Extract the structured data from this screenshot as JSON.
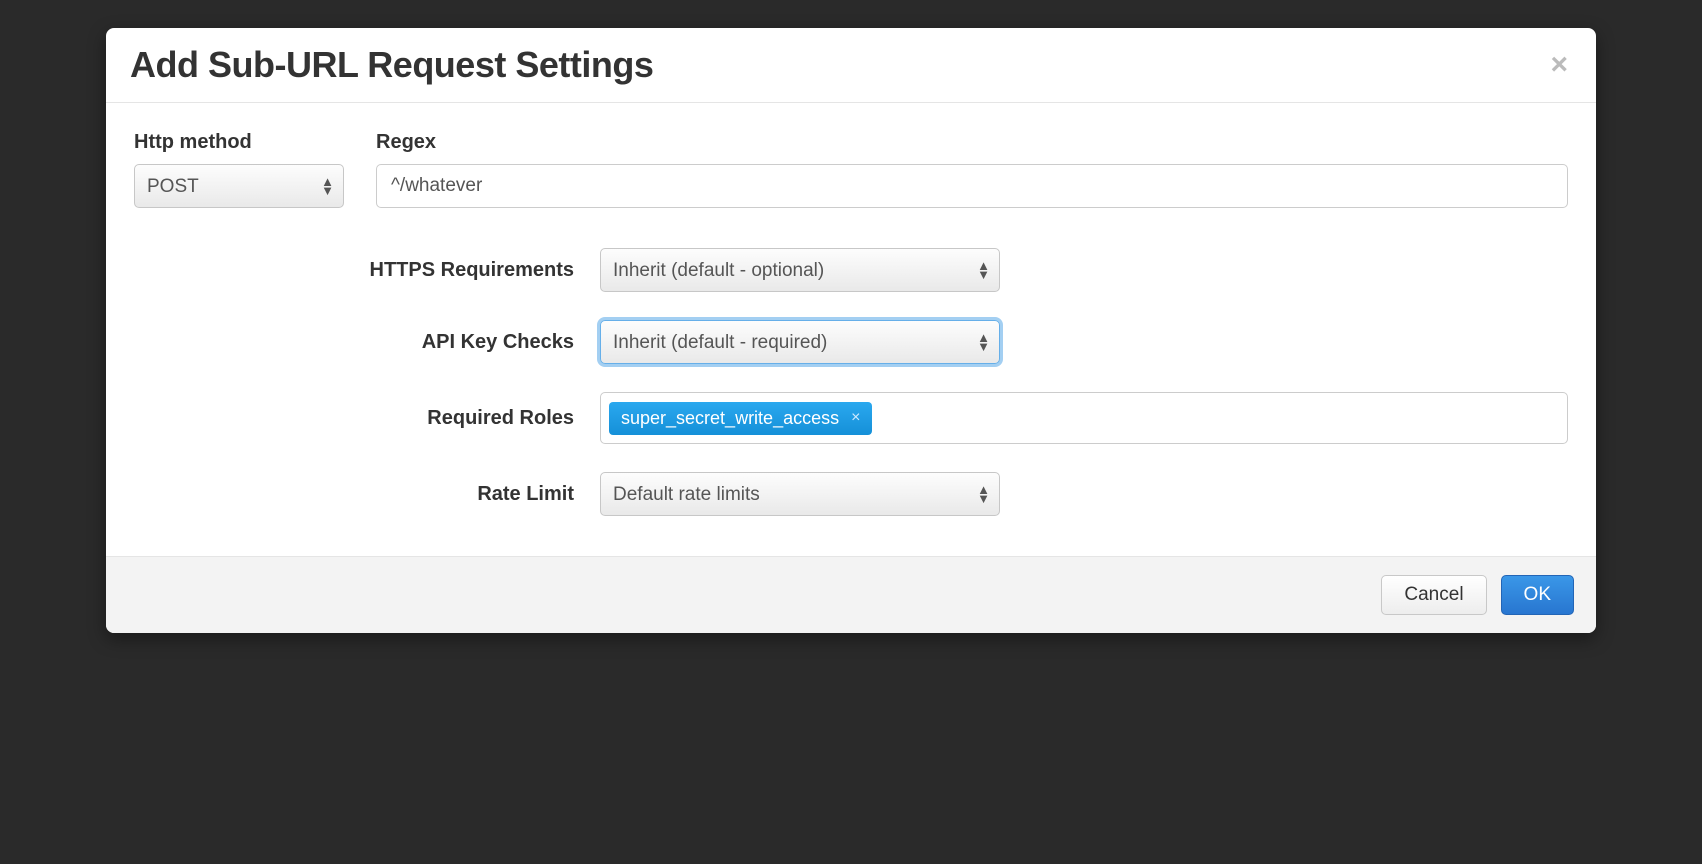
{
  "modal": {
    "title": "Add Sub-URL Request Settings",
    "close_label": "×"
  },
  "fields": {
    "http_method": {
      "label": "Http method",
      "value": "POST"
    },
    "regex": {
      "label": "Regex",
      "value": "^/whatever"
    },
    "https_requirements": {
      "label": "HTTPS Requirements",
      "value": "Inherit (default - optional)"
    },
    "api_key_checks": {
      "label": "API Key Checks",
      "value": "Inherit (default - required)"
    },
    "required_roles": {
      "label": "Required Roles",
      "tags": [
        {
          "text": "super_secret_write_access"
        }
      ],
      "tag_remove": "×"
    },
    "rate_limit": {
      "label": "Rate Limit",
      "value": "Default rate limits"
    }
  },
  "footer": {
    "cancel": "Cancel",
    "ok": "OK"
  }
}
